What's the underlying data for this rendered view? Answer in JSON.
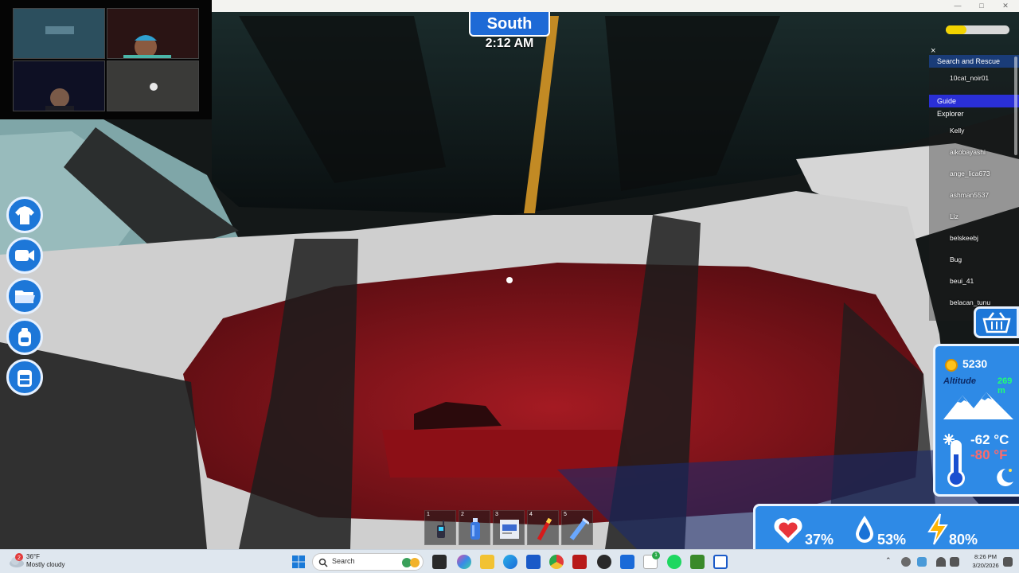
{
  "hud": {
    "compass_direction": "South",
    "clock_time": "2:12 AM",
    "top_progress_fraction": 0.32
  },
  "player_list": {
    "close_glyph": "×",
    "teams": [
      {
        "name": "Search and Rescue",
        "players": [
          "10cat_noir01"
        ]
      },
      {
        "name": "Guide",
        "players": []
      },
      {
        "name": "Explorer",
        "players": [
          "Kelly",
          "aikobayashi",
          "ange_lica673",
          "ashman5537",
          "Liz",
          "belskeebj",
          "Bug",
          "beui_41",
          "belacan_tunu"
        ]
      }
    ]
  },
  "left_buttons": [
    "avatar-shirt-icon",
    "video-camera-icon",
    "folder-icon",
    "backpack-icon",
    "inventory-icon"
  ],
  "stats": {
    "coins": "5230",
    "altitude_label": "Altitude",
    "altitude_value": "269 m",
    "temp_c": "-62 °C",
    "temp_f": "-80 °F",
    "health": "37%",
    "water": "53%",
    "energy": "80%"
  },
  "hotbar": {
    "slots": [
      {
        "number": "1",
        "icon": "walkie-talkie-icon"
      },
      {
        "number": "2",
        "icon": "water-bottle-icon"
      },
      {
        "number": "3",
        "icon": "map-icon"
      },
      {
        "number": "4",
        "icon": "flare-icon"
      },
      {
        "number": "5",
        "icon": "ice-axe-icon"
      }
    ]
  },
  "taskbar": {
    "weather_temp": "36°F",
    "weather_desc": "Mostly cloudy",
    "search_placeholder": "Search",
    "time": "8:26 PM",
    "date": "3/20/2026",
    "notification_count": "2",
    "chrome_badge": "1"
  },
  "colors": {
    "hud_blue": "#2e8ae6",
    "button_blue": "#1d77d8",
    "altitude_green": "#21ff74",
    "fahrenheit_red": "#ff6a6a",
    "progress_yellow": "#f2d300"
  }
}
